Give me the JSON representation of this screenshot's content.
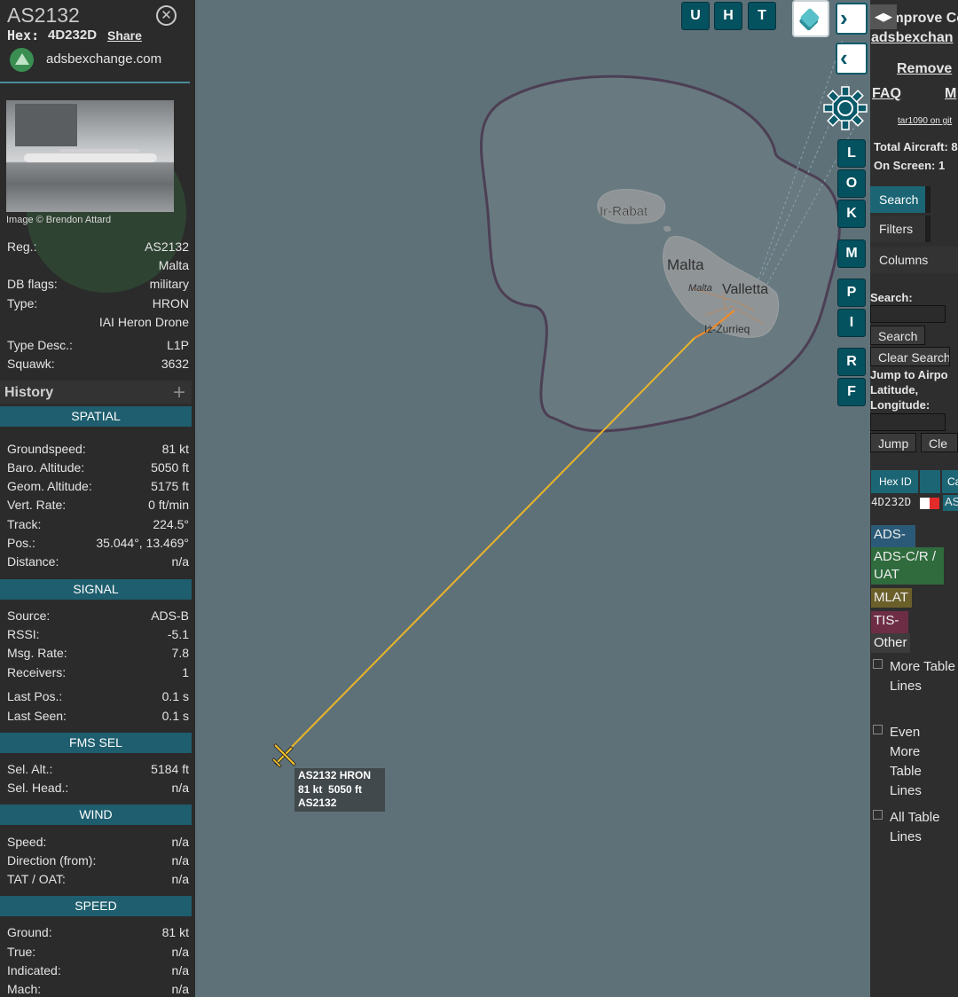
{
  "info": {
    "callsign": "AS2132",
    "hex_label": "Hex:",
    "hex": "4D232D",
    "share": "Share",
    "site_link": "adsbexchange.com",
    "photo_credit": "Image © Brendon Attard",
    "details": [
      {
        "key": "Reg.:",
        "value": "AS2132"
      },
      {
        "key": "",
        "value": "Malta"
      },
      {
        "key": "DB flags:",
        "value": "military"
      },
      {
        "key": "Type:",
        "value": "HRON"
      },
      {
        "key": "",
        "value": "IAI Heron Drone"
      },
      {
        "key": "Type Desc.:",
        "value": "L1P"
      },
      {
        "key": "Squawk:",
        "value": "3632"
      }
    ],
    "history_label": "History",
    "sections": {
      "spatial": {
        "title": "SPATIAL",
        "rows": [
          {
            "key": "Groundspeed:",
            "value": "81 kt"
          },
          {
            "key": "Baro. Altitude:",
            "value": "5050 ft"
          },
          {
            "key": "Geom. Altitude:",
            "value": "5175 ft"
          },
          {
            "key": "Vert. Rate:",
            "value": "0 ft/min"
          },
          {
            "key": "Track:",
            "value": "224.5°"
          },
          {
            "key": "Pos.:",
            "value": "35.044°, 13.469°"
          },
          {
            "key": "Distance:",
            "value": "n/a"
          }
        ]
      },
      "signal": {
        "title": "SIGNAL",
        "rows": [
          {
            "key": "Source:",
            "value": "ADS-B"
          },
          {
            "key": "RSSI:",
            "value": "-5.1"
          },
          {
            "key": "Msg. Rate:",
            "value": "7.8"
          },
          {
            "key": "Receivers:",
            "value": "1"
          },
          {
            "key": "Last Pos.:",
            "value": "0.1 s"
          },
          {
            "key": "Last Seen:",
            "value": "0.1 s"
          }
        ]
      },
      "fms": {
        "title": "FMS SEL",
        "rows": [
          {
            "key": "Sel. Alt.:",
            "value": "5184 ft"
          },
          {
            "key": "Sel. Head.:",
            "value": "n/a"
          }
        ]
      },
      "wind": {
        "title": "WIND",
        "rows": [
          {
            "key": "Speed:",
            "value": "n/a"
          },
          {
            "key": "Direction (from):",
            "value": "n/a"
          },
          {
            "key": "TAT / OAT:",
            "value": "n/a"
          }
        ]
      },
      "speed": {
        "title": "SPEED",
        "rows": [
          {
            "key": "Ground:",
            "value": "81 kt"
          },
          {
            "key": "True:",
            "value": "n/a"
          },
          {
            "key": "Indicated:",
            "value": "n/a"
          },
          {
            "key": "Mach:",
            "value": "n/a"
          }
        ]
      }
    }
  },
  "map": {
    "places": {
      "rabat": "Ir-Rabat",
      "malta": "Malta",
      "malta_small": "Malta",
      "valletta": "Valletta",
      "zurrieq": "Iż-Żurrieq"
    },
    "aircraft_label": {
      "line1": "AS2132 HRON",
      "line2": "81 kt  5050 ft",
      "line3": "AS2132"
    },
    "buttons": {
      "u": "U",
      "h": "H",
      "t": "T",
      "l": "L",
      "o": "O",
      "k": "K",
      "m": "M",
      "p": "P",
      "i": "I",
      "r": "R",
      "f": "F"
    },
    "colors": {
      "track": "#e8b52a",
      "track_end": "#f08a2a",
      "water": "#5f7178",
      "land": "#8a8f90",
      "button": "#04515f"
    }
  },
  "sidebar": {
    "improve": "Improve Co",
    "adsbx": "adsbexchan",
    "remove": "Remove",
    "faq": "FAQ",
    "m": "M",
    "tar1090": "tar1090 on git",
    "total_aircraft": "Total Aircraft: 8",
    "on_screen": "On Screen: 1",
    "tabs": {
      "search": "Search",
      "filters": "Filters",
      "columns": "Columns"
    },
    "search_label": "Search:",
    "search_btn": "Search",
    "clear_search": "Clear Search",
    "jump_label_1": "Jump to Airpo",
    "jump_label_2": "Latitude,",
    "jump_label_3": "Longitude:",
    "jump_btn": "Jump",
    "clear_btn": "Cle",
    "table": {
      "col_hex": "Hex ID",
      "col_flag": "",
      "col_call": "Ca",
      "row_hex": "4D232D",
      "row_call": "AS"
    },
    "legend": {
      "adsb": "ADS-B",
      "adsc": "ADS-C/R / UAT",
      "mlat": "MLAT",
      "tisb": "TIS-B",
      "other": "Other"
    },
    "checkboxes": {
      "more": "More Table Lines",
      "even_more": "Even More Table Lines",
      "all": "All Table Lines"
    }
  }
}
